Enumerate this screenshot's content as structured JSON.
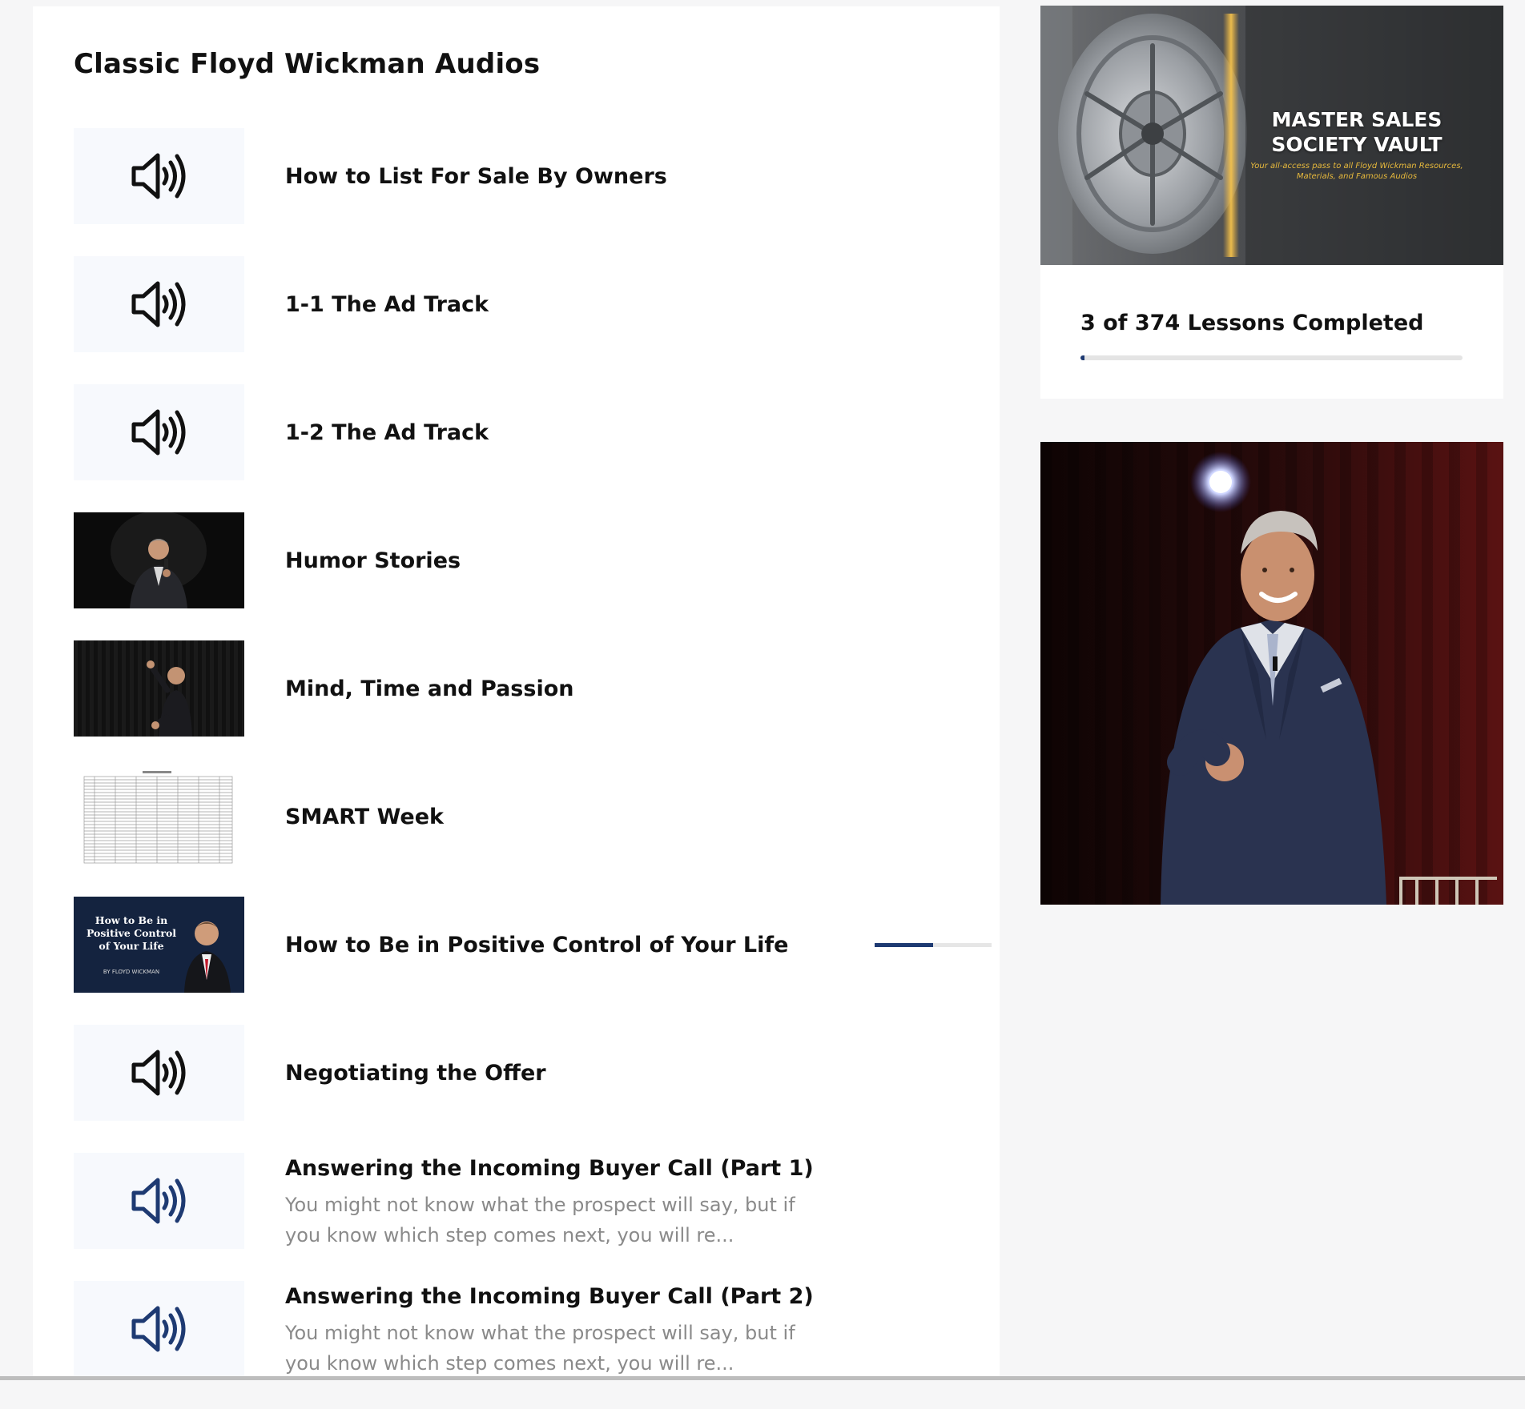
{
  "section": {
    "title": "Classic Floyd Wickman Audios"
  },
  "lessons": [
    {
      "title": "How to List For Sale By Owners",
      "thumb": "speaker-icon",
      "desc": "",
      "progress": null
    },
    {
      "title": "1-1 The Ad Track",
      "thumb": "speaker-icon",
      "desc": "",
      "progress": null
    },
    {
      "title": "1-2 The Ad Track",
      "thumb": "speaker-icon",
      "desc": "",
      "progress": null
    },
    {
      "title": "Humor Stories",
      "thumb": "speaker-photo-microphone",
      "desc": "",
      "progress": null
    },
    {
      "title": "Mind, Time and Passion",
      "thumb": "speaker-photo-gesturing",
      "desc": "",
      "progress": null
    },
    {
      "title": "SMART Week",
      "thumb": "spreadsheet-preview",
      "desc": "",
      "progress": null
    },
    {
      "title": "How to Be in Positive Control of Your Life",
      "thumb": "book-cover",
      "desc": "",
      "progress": 0.5,
      "cover_title": "How to Be in Positive Control of Your Life",
      "cover_author": "BY FLOYD WICKMAN"
    },
    {
      "title": "Negotiating the Offer",
      "thumb": "speaker-icon",
      "desc": "",
      "progress": null
    },
    {
      "title": "Answering the Incoming Buyer Call (Part 1)",
      "thumb": "speaker-icon-blue",
      "desc": "You might not know what the prospect will say, but if you know which step comes next, you will re...",
      "progress": null
    },
    {
      "title": "Answering the Incoming Buyer Call (Part 2)",
      "thumb": "speaker-icon-blue",
      "desc": "You might not know what the prospect will say, but if you know which step comes next, you will re...",
      "progress": null
    }
  ],
  "sidebar": {
    "vault_title_line1": "MASTER SALES",
    "vault_title_line2": "SOCIETY VAULT",
    "vault_subtitle": "Your all-access pass to all Floyd Wickman Resources, Materials, and Famous Audios",
    "progress_label": "3 of 374 Lessons Completed",
    "completed": 3,
    "total": 374
  },
  "colors": {
    "accent": "#1e3a72",
    "icon_dark": "#111111",
    "icon_blue": "#1e3a72",
    "vault_gold": "#e7b93c"
  }
}
